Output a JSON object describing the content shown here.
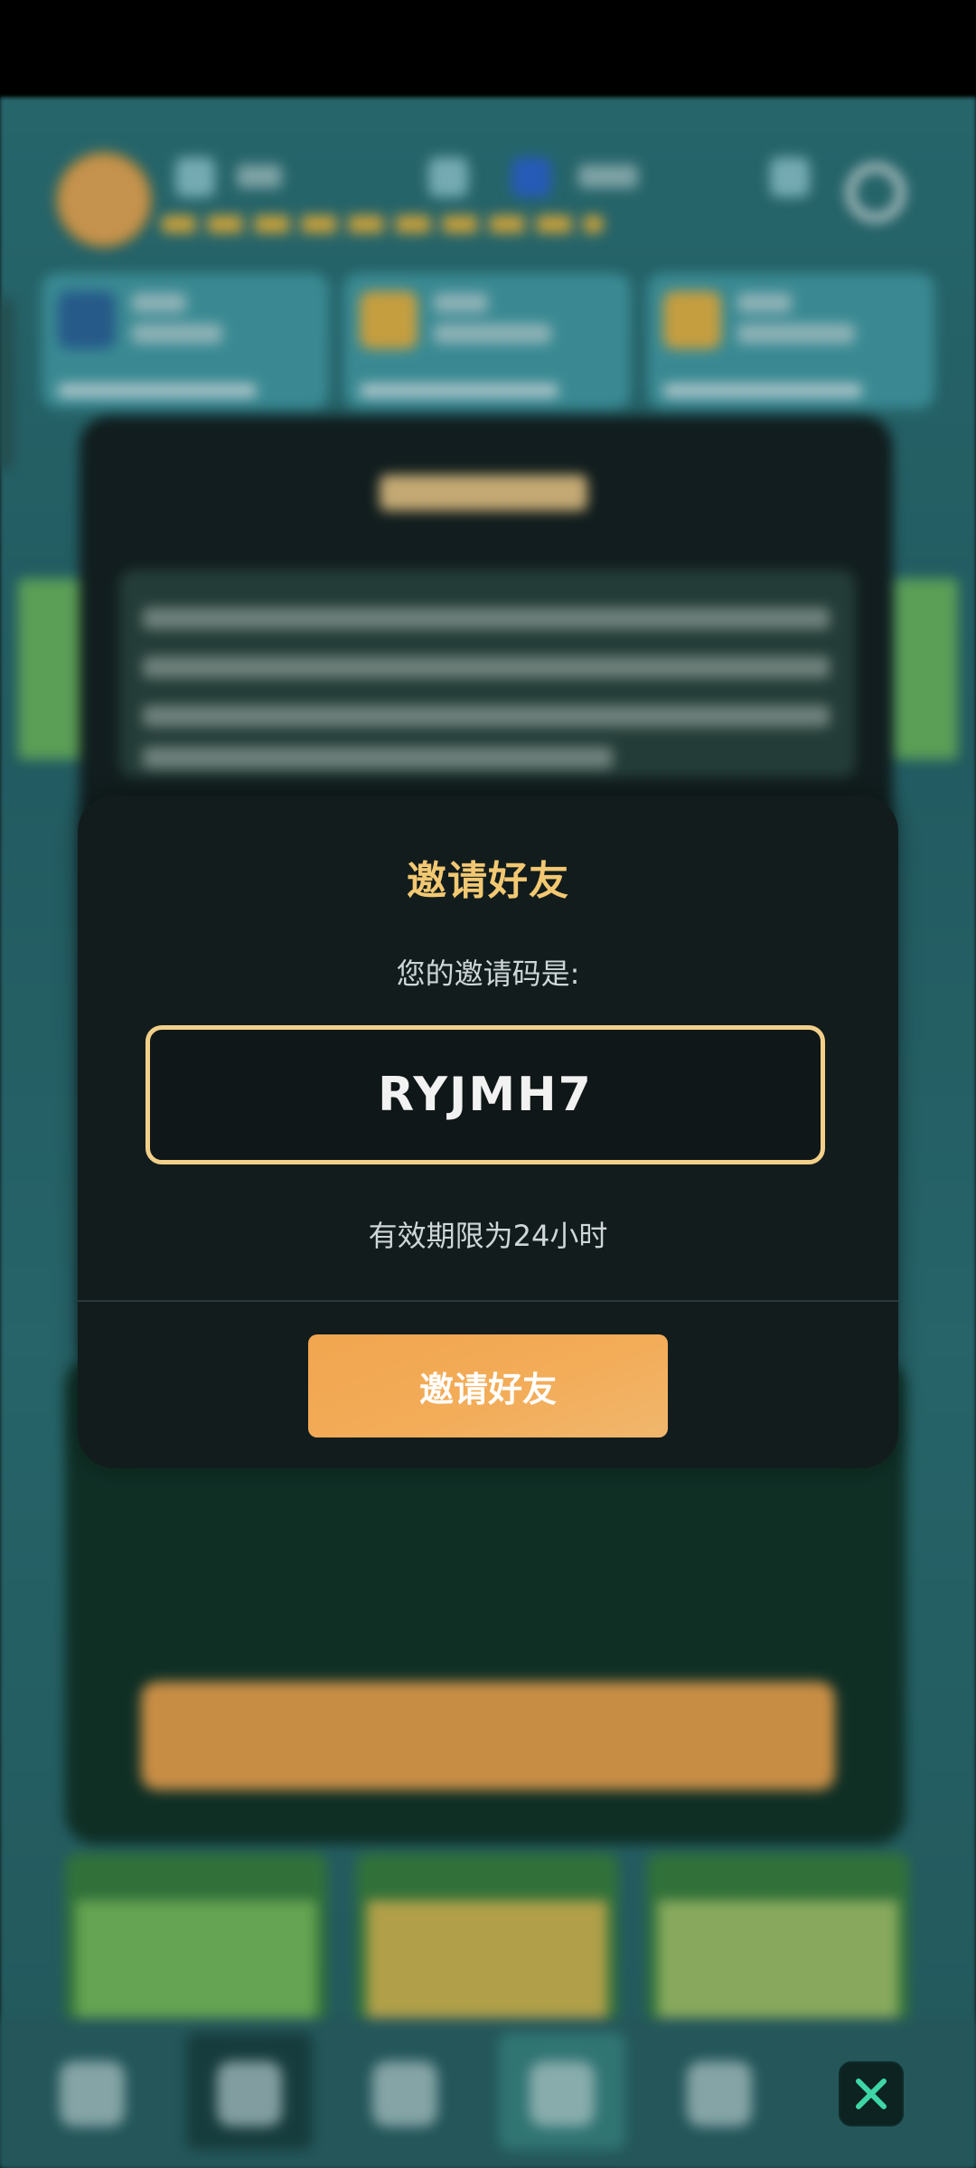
{
  "invite_modal": {
    "title": "邀请好友",
    "subtitle": "您的邀请码是:",
    "invite_code": "RYJMH7",
    "validity_text": "有效期限为24小时",
    "invite_button_label": "邀请好友"
  },
  "icons": {
    "close": "close-icon",
    "settings": "gear-icon"
  },
  "colors": {
    "accent_gold": "#f2c872",
    "button_orange": "#f3ac58",
    "modal_bg": "#121c1d",
    "close_green": "#3fd6a6"
  }
}
